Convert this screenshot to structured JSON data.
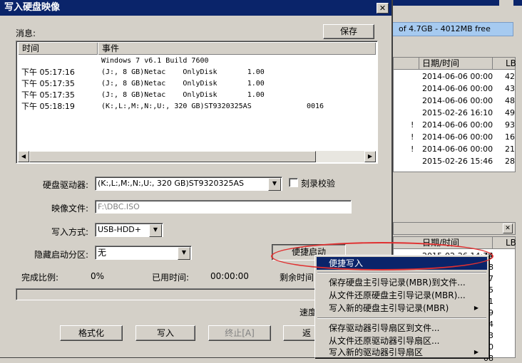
{
  "dialog": {
    "title": "写入硬盘映像",
    "close_glyph": "✕",
    "message_label": "消息:",
    "save_button": "保存",
    "log": {
      "columns": [
        "时间",
        "事件"
      ],
      "rows": [
        {
          "time": "",
          "event": "Windows 7 v6.1 Build 7600",
          "extra": ""
        },
        {
          "time": "下午 05:17:16",
          "event": "(J:, 8 GB)Netac    OnlyDisk       1.00",
          "extra": ""
        },
        {
          "time": "下午 05:17:35",
          "event": "(J:, 8 GB)Netac    OnlyDisk       1.00",
          "extra": ""
        },
        {
          "time": "下午 05:17:35",
          "event": "(J:, 8 GB)Netac    OnlyDisk       1.00",
          "extra": ""
        },
        {
          "time": "下午 05:18:19",
          "event": "(K:,L:,M:,N:,U:, 320 GB)ST9320325AS",
          "extra": "0016"
        }
      ]
    },
    "drive_label": "硬盘驱动器:",
    "drive_value": "(K:,L:,M:,N:,U:, 320 GB)ST9320325AS",
    "verify_label": "刻录校验",
    "image_label": "映像文件:",
    "image_value": "F:\\DBC.ISO",
    "write_mode_label": "写入方式:",
    "write_mode_value": "USB-HDD+",
    "hidden_label": "隐藏启动分区:",
    "hidden_value": "无",
    "quick_start_button": "便捷启动",
    "progress_label": "完成比例:",
    "progress_value": "0%",
    "elapsed_label": "已用时间:",
    "elapsed_value": "00:00:00",
    "remaining_label": "剩余时间",
    "speed_label": "速度",
    "progress_fraction": 0,
    "buttons": {
      "format": "格式化",
      "write": "写入",
      "stop": "终止[A]",
      "back": "返"
    }
  },
  "background": {
    "free_space": "of 4.7GB - 4012MB free",
    "panel1": {
      "columns": [
        "日期/时间",
        "LB"
      ],
      "rows": [
        {
          "mark": "",
          "date": "2014-06-06 00:00",
          "lb": "42"
        },
        {
          "mark": "",
          "date": "2014-06-06 00:00",
          "lb": "43"
        },
        {
          "mark": "",
          "date": "2014-06-06 00:00",
          "lb": "48"
        },
        {
          "mark": "",
          "date": "2015-02-26 16:10",
          "lb": "49"
        },
        {
          "mark": "!",
          "date": "2014-06-06 00:00",
          "lb": "93"
        },
        {
          "mark": "!",
          "date": "2014-06-06 00:00",
          "lb": "16"
        },
        {
          "mark": "!",
          "date": "2014-06-06 00:00",
          "lb": "21"
        },
        {
          "mark": "",
          "date": "2015-02-26 15:46",
          "lb": "28"
        }
      ]
    },
    "panel2": {
      "columns": [
        "日期/时间",
        "LB"
      ],
      "partial_date": "2015-02-26 14:38",
      "lb_values": [
        "44",
        "58",
        "27",
        "55",
        "01",
        "39",
        "04",
        "63",
        "70",
        "08"
      ]
    }
  },
  "context_menu": {
    "items": [
      {
        "label": "便捷写入",
        "selected": true,
        "submenu": false
      },
      {
        "label": "保存硬盘主引导记录(MBR)到文件...",
        "selected": false,
        "submenu": false
      },
      {
        "label": "从文件还原硬盘主引导记录(MBR)...",
        "selected": false,
        "submenu": false
      },
      {
        "label": "写入新的硬盘主引导记录(MBR)",
        "selected": false,
        "submenu": true
      },
      {
        "label": "保存驱动器引导扇区到文件...",
        "selected": false,
        "submenu": false
      },
      {
        "label": "从文件还原驱动器引导扇区...",
        "selected": false,
        "submenu": false
      },
      {
        "label": "写入新的驱动器引导扇区",
        "selected": false,
        "submenu": true
      }
    ]
  }
}
